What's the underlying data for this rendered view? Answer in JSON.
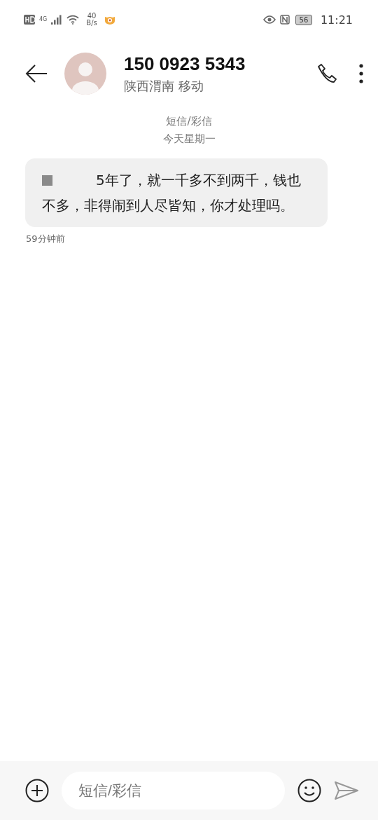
{
  "status_bar": {
    "network": "4G",
    "speed_value": "40",
    "speed_unit": "B/s",
    "battery": "56",
    "time": "11:21"
  },
  "header": {
    "title": "150 0923 5343",
    "subtitle": "陕西渭南 移动"
  },
  "thread": {
    "channel": "短信/彩信",
    "date": "今天星期一",
    "messages": [
      {
        "redacted": true,
        "text": "5年了，就一千多不到两千，钱也不多，非得闹到人尽皆知，你才处理吗。",
        "time": "59分钟前"
      }
    ]
  },
  "composer": {
    "placeholder": "短信/彩信"
  }
}
